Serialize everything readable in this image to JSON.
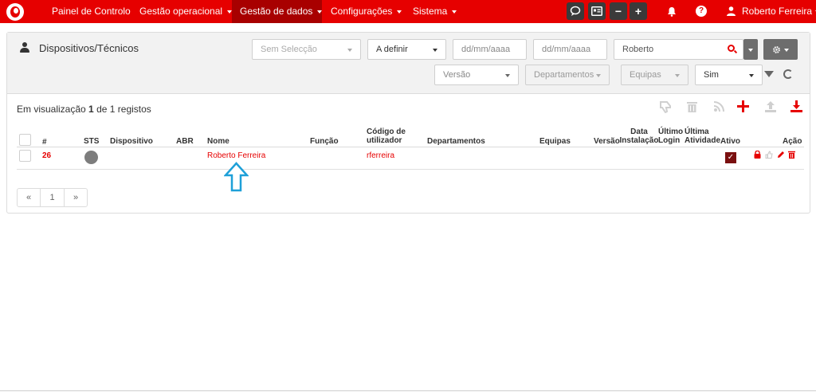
{
  "nav": {
    "items": [
      {
        "label": "Painel de Controlo",
        "caret": false,
        "active": false
      },
      {
        "label": "Gestão operacional",
        "caret": true,
        "active": false
      },
      {
        "label": "Gestão de dados",
        "caret": true,
        "active": true
      },
      {
        "label": "Configurações",
        "caret": true,
        "active": false
      },
      {
        "label": "Sistema",
        "caret": true,
        "active": false
      }
    ],
    "buttons": {
      "minus": "−",
      "plus": "+"
    },
    "help": "?",
    "user_name": "Roberto Ferreira"
  },
  "colors": {
    "brand": "#e60000",
    "active_nav": "#a80000",
    "checked": "#7a1010",
    "status_dot": "#7d7d7d",
    "arrow": "#1ea0d8"
  },
  "panel": {
    "title": "Dispositivos/Técnicos",
    "filters": {
      "selection": "Sem Selecção",
      "state": "A definir",
      "date_from_placeholder": "dd/mm/aaaa",
      "date_to_placeholder": "dd/mm/aaaa",
      "search_value": "Roberto",
      "version": "Versão",
      "departments": "Departamentos",
      "teams": "Equipas",
      "active": "Sim"
    },
    "info": {
      "prefix": "Em visualização",
      "shown": "1",
      "middle": "de 1 registos"
    }
  },
  "table": {
    "headers": {
      "num": "#",
      "sts": "STS",
      "device": "Dispositivo",
      "abr": "ABR",
      "name": "Nome",
      "role": "Função",
      "user_code_1": "Código de",
      "user_code_2": "utilizador",
      "departments": "Departamentos",
      "teams": "Equipas",
      "version": "Versão",
      "install_1": "Data",
      "install_2": "Instalação",
      "last_login_1": "Último",
      "last_login_2": "Login",
      "last_activity_1": "Última",
      "last_activity_2": "Atividade",
      "active": "Ativo",
      "action": "Ação"
    },
    "rows": [
      {
        "id": "26",
        "name": "Roberto Ferreira",
        "user_code": "rferreira",
        "active_mark": "✓"
      }
    ]
  },
  "pager": {
    "first": "«",
    "page": "1",
    "last": "»"
  }
}
